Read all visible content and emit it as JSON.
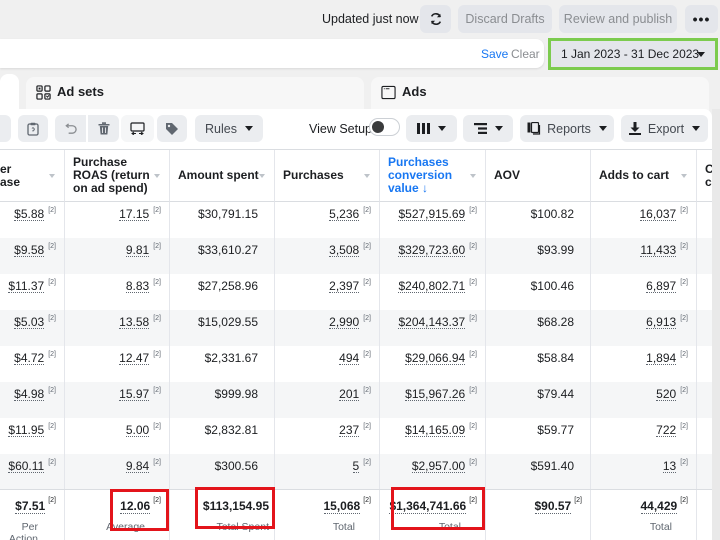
{
  "topbar": {
    "status": "Updated just now",
    "refresh_icon": "refresh-icon",
    "discard_label": "Discard Drafts",
    "review_label": "Review and publish",
    "more_label": "•••"
  },
  "filterbar": {
    "save_label": "Save",
    "clear_label": "Clear",
    "date_range": "1 Jan 2023 - 31 Dec 2023",
    "highlight_color": "#7ccb4e"
  },
  "tabs": [
    {
      "label": "",
      "icon": "campaigns-icon"
    },
    {
      "label": "Ad sets",
      "icon": "grid-icon"
    },
    {
      "label": "Ads",
      "icon": "window-icon"
    }
  ],
  "toolbar": {
    "rules_label": "Rules",
    "view_setup_label": "View Setup",
    "view_setup_on": false,
    "reports_label": "Reports",
    "export_label": "Export"
  },
  "table": {
    "columns": [
      {
        "label": "er\nase",
        "lines": [
          "er",
          "ase"
        ]
      },
      {
        "label": "Purchase ROAS (return on ad spend)",
        "lines": [
          "Purchase",
          "ROAS (return",
          "on ad spend)"
        ]
      },
      {
        "label": "Amount spent",
        "lines": [
          "Amount spent"
        ]
      },
      {
        "label": "Purchases",
        "lines": [
          "Purchases"
        ]
      },
      {
        "label": "Purchases conversion value ↓",
        "lines": [
          "Purchases",
          "conversion",
          "value ↓"
        ],
        "sorted": true
      },
      {
        "label": "AOV",
        "lines": [
          "AOV"
        ]
      },
      {
        "label": "Adds to cart",
        "lines": [
          "Adds to cart"
        ]
      },
      {
        "label": "Co ca",
        "lines": [
          "Co",
          "ca"
        ]
      }
    ],
    "rows": [
      [
        "$5.88",
        "17.15",
        "$30,791.15",
        "5,236",
        "$527,915.69",
        "$100.82",
        "16,037"
      ],
      [
        "$9.58",
        "9.81",
        "$33,610.27",
        "3,508",
        "$329,723.60",
        "$93.99",
        "11,433"
      ],
      [
        "$11.37",
        "8.83",
        "$27,258.96",
        "2,397",
        "$240,802.71",
        "$100.46",
        "6,897"
      ],
      [
        "$5.03",
        "13.58",
        "$15,029.55",
        "2,990",
        "$204,143.37",
        "$68.28",
        "6,913"
      ],
      [
        "$4.72",
        "12.47",
        "$2,331.67",
        "494",
        "$29,066.94",
        "$58.84",
        "1,894"
      ],
      [
        "$4.98",
        "15.97",
        "$999.98",
        "201",
        "$15,967.26",
        "$79.44",
        "520"
      ],
      [
        "$11.95",
        "5.00",
        "$2,832.81",
        "237",
        "$14,165.09",
        "$59.77",
        "722"
      ],
      [
        "$60.11",
        "9.84",
        "$300.56",
        "5",
        "$2,957.00",
        "$591.40",
        "13"
      ]
    ],
    "footnote": "[2]",
    "totals": [
      {
        "value": "$7.51",
        "label": "Per Action",
        "fn": true
      },
      {
        "value": "12.06",
        "label": "Average",
        "fn": true,
        "highlight": true
      },
      {
        "value": "$113,154.95",
        "label": "Total Spent",
        "fn": false,
        "highlight": true
      },
      {
        "value": "15,068",
        "label": "Total",
        "fn": true
      },
      {
        "value": "$1,364,741.66",
        "label": "Total",
        "fn": true,
        "highlight": true
      },
      {
        "value": "$90.57",
        "label": "",
        "fn": true
      },
      {
        "value": "44,429",
        "label": "Total",
        "fn": true
      }
    ],
    "highlight_color": "#e3141b"
  }
}
